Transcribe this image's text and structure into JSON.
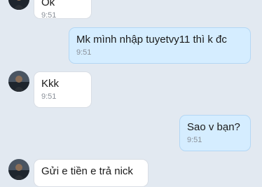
{
  "messages": [
    {
      "text": "Ok",
      "time": "9:51"
    },
    {
      "text": "Mk mình nhập tuyetvy11 thì k đc",
      "time": "9:51"
    },
    {
      "text": "Kkk",
      "time": "9:51"
    },
    {
      "text": "Sao v bạn?",
      "time": "9:51"
    },
    {
      "text": "Gửi e tiền e trả nick",
      "time": ""
    }
  ],
  "colors": {
    "background": "#e2e9f1",
    "incoming_bubble": "#ffffff",
    "outgoing_bubble": "#d5edff",
    "timestamp": "#8a9099"
  },
  "icons": {
    "avatar": "contact-avatar-icon"
  }
}
